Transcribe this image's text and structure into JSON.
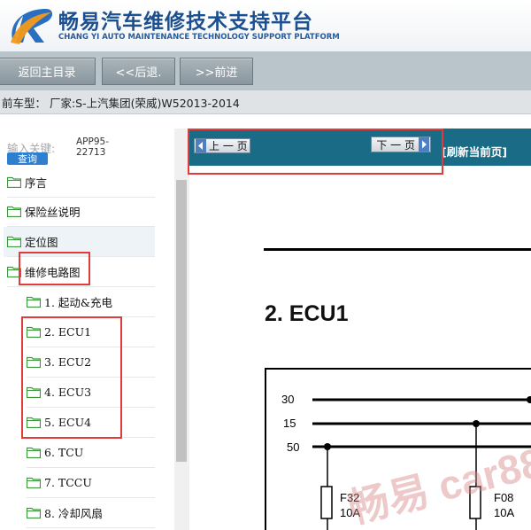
{
  "header": {
    "title": "畅易汽车维修技术支持平台",
    "subtitle": "CHANG YI AUTO MAINTENANCE TECHNOLOGY SUPPORT PLATFORM",
    "logo_icon": "stylized-r-logo",
    "colors": {
      "title": "#1c4f8f",
      "logo_orange": "#f39a1a",
      "logo_blue": "#2a6fbf"
    }
  },
  "toolbar": {
    "home_label": "返回主目录",
    "back_label": "<<后退.",
    "forward_label": ">>前进"
  },
  "model_bar": {
    "text": "前车型： 厂家:S-上汽集团(荣威)W52013-2014"
  },
  "search": {
    "keyword_label": "输入关键:",
    "button_label": "查询",
    "app_code": "APP95-22713"
  },
  "tree": {
    "items": [
      {
        "label": "序言",
        "level": 0
      },
      {
        "label": "保险丝说明",
        "level": 0
      },
      {
        "label": "定位图",
        "level": 0
      },
      {
        "label": "维修电路图",
        "level": 0
      },
      {
        "label": "1. 起动&充电",
        "level": 1
      },
      {
        "label": "2. ECU1",
        "level": 1
      },
      {
        "label": "3. ECU2",
        "level": 1
      },
      {
        "label": "4. ECU3",
        "level": 1
      },
      {
        "label": "5. ECU4",
        "level": 1
      },
      {
        "label": "6. TCU",
        "level": 1
      },
      {
        "label": "7. TCCU",
        "level": 1
      },
      {
        "label": "8. 冷却风扇",
        "level": 1
      }
    ],
    "folder_icon": "folder-icon",
    "folder_color": "#3a9a3a"
  },
  "pager": {
    "prev_label": "上 一 页",
    "next_label": "下 一 页",
    "refresh_label": "[刷新当前页]"
  },
  "document": {
    "heading": "2. ECU1",
    "diagram": {
      "rails": [
        "30",
        "15",
        "50"
      ],
      "fuses": [
        {
          "name": "F32",
          "rating": "10A"
        },
        {
          "name": "F08",
          "rating": "10A"
        }
      ]
    }
  },
  "watermark": {
    "text": "畅易 car88"
  },
  "colors": {
    "accent_red": "#e23b3b",
    "content_bar": "#1a6b86",
    "toolbar": "#b9c4cb"
  }
}
